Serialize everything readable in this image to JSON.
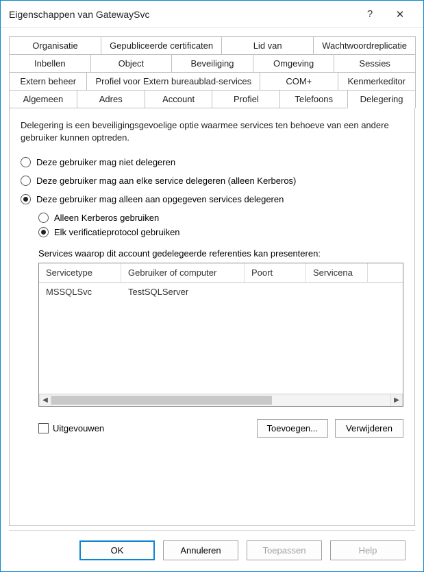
{
  "title": "Eigenschappen van GatewaySvc",
  "tabs": {
    "row1": [
      "Organisatie",
      "Gepubliceerde certificaten",
      "Lid van",
      "Wachtwoordreplicatie"
    ],
    "row2": [
      "Inbellen",
      "Object",
      "Beveiliging",
      "Omgeving",
      "Sessies"
    ],
    "row3": [
      "Extern beheer",
      "Profiel voor Extern bureaublad-services",
      "COM+",
      "Kenmerkeditor"
    ],
    "row4": [
      "Algemeen",
      "Adres",
      "Account",
      "Profiel",
      "Telefoons",
      "Delegering"
    ]
  },
  "active_tab": "Delegering",
  "delegation": {
    "intro": "Delegering is een beveiligingsgevoelige optie waarmee services ten behoeve van een andere gebruiker kunnen optreden.",
    "opt_no_delegate": "Deze gebruiker mag niet delegeren",
    "opt_delegate_any": "Deze gebruiker mag aan elke service delegeren (alleen Kerberos)",
    "opt_delegate_specified": "Deze gebruiker mag alleen aan opgegeven services delegeren",
    "sel_top": "opt_delegate_specified",
    "opt_kerberos_only": "Alleen Kerberos gebruiken",
    "opt_any_protocol": "Elk verificatieprotocol gebruiken",
    "sel_sub": "opt_any_protocol",
    "services_label": "Services waarop dit account gedelegeerde referenties kan presenteren:",
    "columns": {
      "c1": "Servicetype",
      "c2": "Gebruiker of computer",
      "c3": "Poort",
      "c4": "Servicena"
    },
    "rows": [
      {
        "c1": "MSSQLSvc",
        "c2": "TestSQLServer",
        "c3": "",
        "c4": ""
      }
    ],
    "expanded_label": "Uitgevouwen",
    "expanded_checked": false,
    "add_label": "Toevoegen...",
    "remove_label": "Verwijderen"
  },
  "footer": {
    "ok": "OK",
    "cancel": "Annuleren",
    "apply": "Toepassen",
    "help": "Help"
  }
}
